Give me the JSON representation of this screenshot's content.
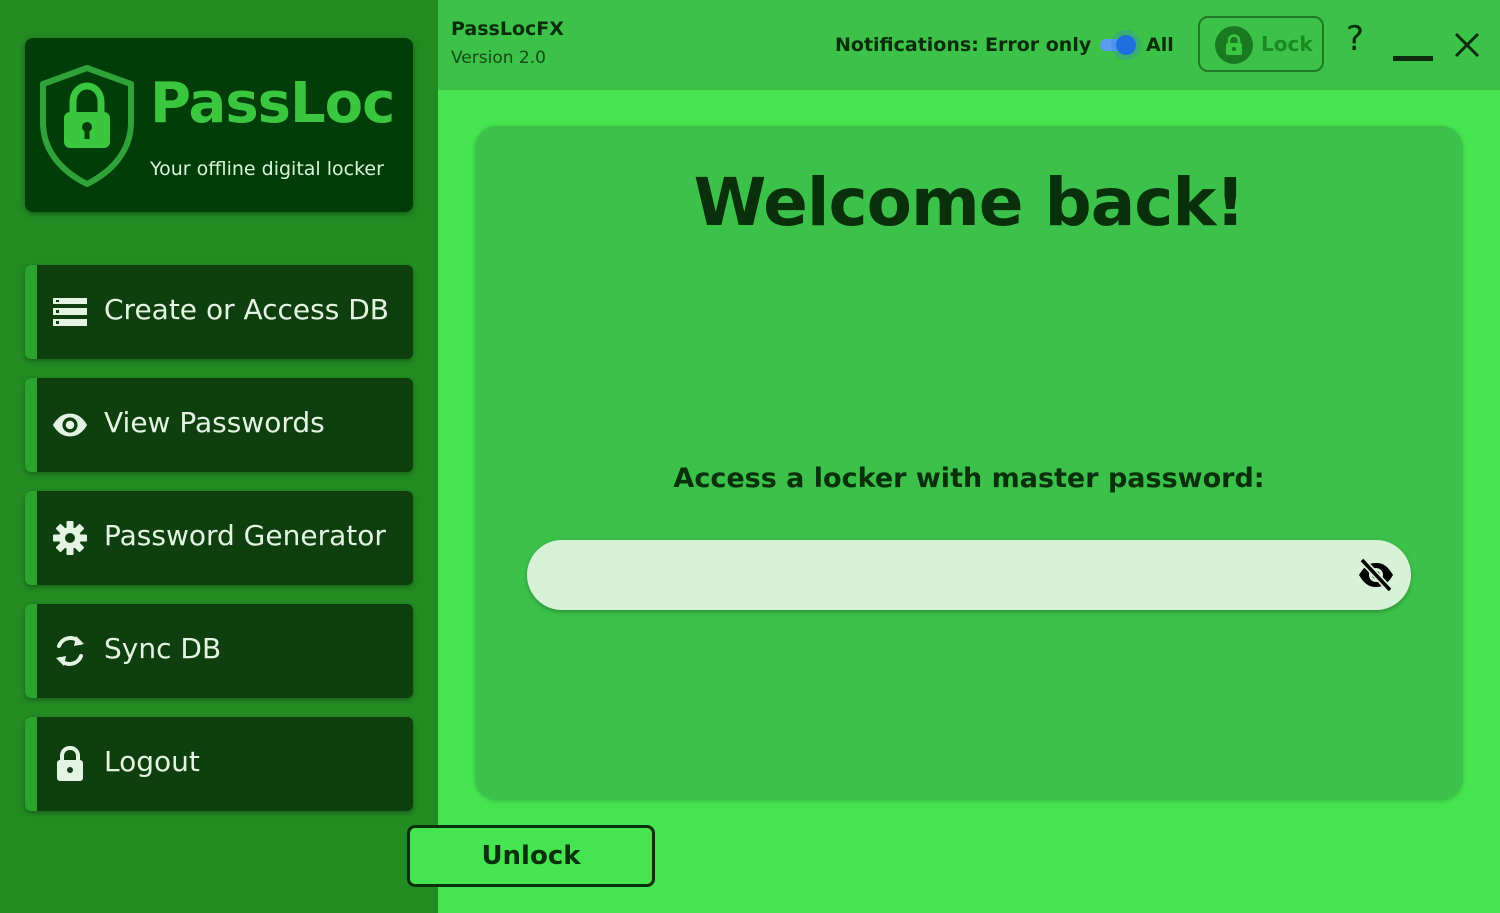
{
  "brand": {
    "name": "PassLoc",
    "tagline": "Your offline digital locker",
    "icon": "shield-lock-icon"
  },
  "sidebar": {
    "items": [
      {
        "label": "Create or Access DB",
        "icon": "database-icon"
      },
      {
        "label": "View Passwords",
        "icon": "eye-icon"
      },
      {
        "label": "Password Generator",
        "icon": "gear-icon"
      },
      {
        "label": "Sync DB",
        "icon": "sync-icon"
      },
      {
        "label": "Logout",
        "icon": "lock-icon"
      }
    ]
  },
  "titlebar": {
    "app_name": "PassLocFX",
    "version": "Version 2.0",
    "notifications_label": "Notifications:",
    "notifications_error_only": "Error only",
    "notifications_all": "All",
    "notifications_toggle_on": true,
    "lock_label": "Lock",
    "help_label": "?"
  },
  "main": {
    "welcome": "Welcome back!",
    "access_label": "Access a locker with master password:",
    "password_value": "",
    "password_placeholder": "",
    "unlock_label": "Unlock"
  },
  "colors": {
    "sidebar_bg": "#228b22",
    "sidebar_item_bg": "#0f3f0f",
    "brand_card_bg": "#003d08",
    "brand_green": "#3ac63f",
    "main_bg": "#45e450",
    "topbar_bg": "#3cc248",
    "card_bg": "#3cc14a",
    "input_bg": "#d8f2d7",
    "toggle_blue": "#1f6fe0",
    "text_dark": "#0a300b"
  }
}
